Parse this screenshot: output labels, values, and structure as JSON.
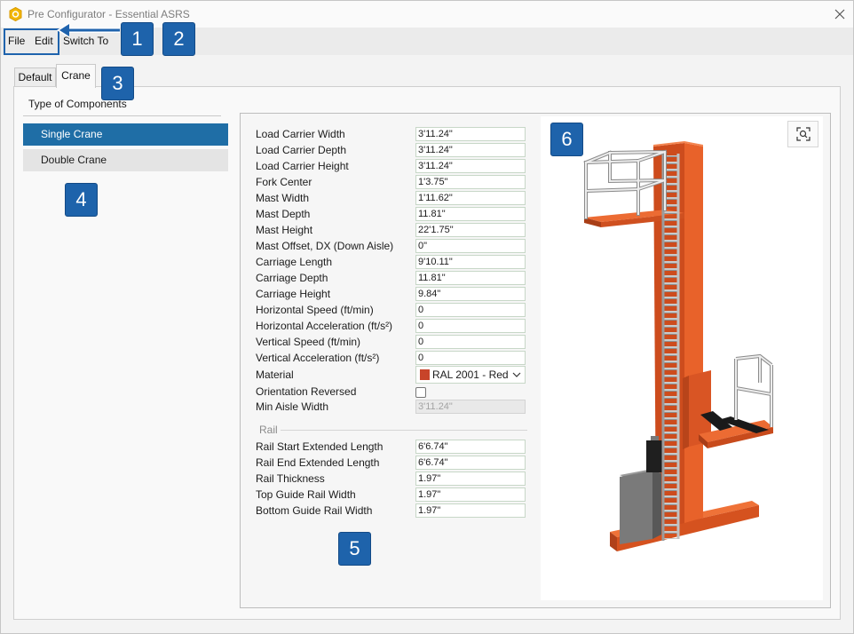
{
  "window": {
    "title": "Pre Configurator - Essential ASRS",
    "app_icon": "app-hexagon-icon",
    "close_icon": "close-icon"
  },
  "menu": {
    "items": [
      "File",
      "Edit",
      "Switch To"
    ]
  },
  "callouts": [
    "1",
    "2",
    "3",
    "4",
    "5",
    "6"
  ],
  "tabs": [
    {
      "label": "Default",
      "selected": false
    },
    {
      "label": "Crane",
      "selected": true
    }
  ],
  "components": {
    "heading": "Type of Components",
    "items": [
      {
        "label": "Single Crane",
        "selected": true
      },
      {
        "label": "Double Crane",
        "selected": false
      }
    ]
  },
  "properties": [
    {
      "label": "Load Carrier Width",
      "value": "3'11.24\""
    },
    {
      "label": "Load Carrier Depth",
      "value": "3'11.24\""
    },
    {
      "label": "Load Carrier Height",
      "value": "3'11.24\""
    },
    {
      "label": "Fork Center",
      "value": "1'3.75\""
    },
    {
      "label": "Mast Width",
      "value": "1'11.62\""
    },
    {
      "label": "Mast Depth",
      "value": "11.81\""
    },
    {
      "label": "Mast Height",
      "value": "22'1.75\""
    },
    {
      "label": "Mast Offset, DX (Down Aisle)",
      "value": "0\""
    },
    {
      "label": "Carriage Length",
      "value": "9'10.11\""
    },
    {
      "label": "Carriage Depth",
      "value": "11.81\""
    },
    {
      "label": "Carriage Height",
      "value": "9.84\""
    },
    {
      "label": "Horizontal Speed (ft/min)",
      "value": "0"
    },
    {
      "label": "Horizontal Acceleration (ft/s²)",
      "value": "0"
    },
    {
      "label": "Vertical Speed (ft/min)",
      "value": "0"
    },
    {
      "label": "Vertical Acceleration (ft/s²)",
      "value": "0"
    }
  ],
  "material": {
    "label": "Material",
    "value": "RAL 2001 - Red",
    "swatch_color": "#c8442a",
    "dropdown_icon": "chevron-down-icon"
  },
  "orientation": {
    "label": "Orientation Reversed",
    "checked": false
  },
  "min_aisle": {
    "label": "Min Aisle Width",
    "value": "3'11.24\"",
    "disabled": true
  },
  "rail": {
    "heading": "Rail",
    "properties": [
      {
        "label": "Rail Start Extended Length",
        "value": "6'6.74\""
      },
      {
        "label": "Rail End Extended Length",
        "value": "6'6.74\""
      },
      {
        "label": "Rail Thickness",
        "value": "1.97\""
      },
      {
        "label": "Top Guide Rail Width",
        "value": "1.97\""
      },
      {
        "label": "Bottom Guide Rail Width",
        "value": "1.97\""
      }
    ]
  },
  "viewer": {
    "zoom_icon": "zoom-fit-icon"
  },
  "colors": {
    "callout": "#1e63ab",
    "selection": "#1f6ea6",
    "crane_orange": "#e05a24",
    "material_swatch": "#c8442a"
  }
}
